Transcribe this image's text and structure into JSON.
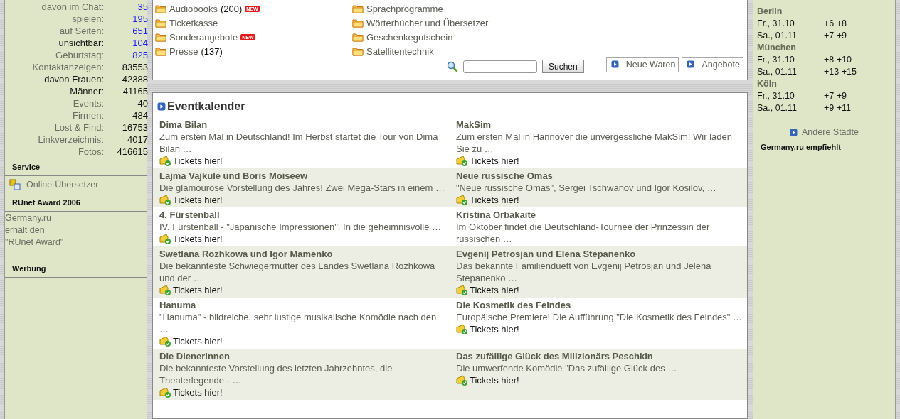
{
  "stats": [
    {
      "label": "davon im Chat:",
      "value": "35",
      "value_link": true,
      "label_strong": false
    },
    {
      "label": "spielen:",
      "value": "195",
      "value_link": true,
      "label_strong": false
    },
    {
      "label": "auf Seiten:",
      "value": "651",
      "value_link": true,
      "label_strong": false
    },
    {
      "label": "unsichtbar:",
      "value": "104",
      "value_link": true,
      "label_strong": true
    },
    {
      "label": "Geburtstag:",
      "value": "825",
      "value_link": true,
      "label_strong": false
    },
    {
      "label": "Kontaktanzeigen:",
      "value": "83553",
      "value_link": false,
      "label_strong": false
    },
    {
      "label": "davon Frauen:",
      "value": "42388",
      "value_link": false,
      "label_strong": true
    },
    {
      "label": "Männer:",
      "value": "41165",
      "value_link": false,
      "label_strong": true
    },
    {
      "label": "Events:",
      "value": "40",
      "value_link": false,
      "label_strong": false
    },
    {
      "label": "Firmen:",
      "value": "484",
      "value_link": false,
      "label_strong": false
    },
    {
      "label": "Lost & Find:",
      "value": "16753",
      "value_link": false,
      "label_strong": false
    },
    {
      "label": "Linkverzeichnis:",
      "value": "4017",
      "value_link": false,
      "label_strong": false
    },
    {
      "label": "Fotos:",
      "value": "416615",
      "value_link": false,
      "label_strong": false
    }
  ],
  "service": {
    "heading": "Service",
    "link": "Online-Übersetzer"
  },
  "award": {
    "heading": "RUnet Award 2006",
    "lines": [
      "Germany.ru",
      "erhält den",
      "\"RUnet Award\""
    ]
  },
  "ads": {
    "heading": "Werbung"
  },
  "categories": [
    {
      "name": "Audiobooks",
      "count": "(200)",
      "new_badge": "NEW"
    },
    {
      "name": "Sprachprogramme"
    },
    {
      "name": "Ticketkasse"
    },
    {
      "name": "Wörterbücher und Übersetzer"
    },
    {
      "name": "Sonderangebote",
      "new_badge": "NEW"
    },
    {
      "name": "Geschenkegutschein"
    },
    {
      "name": "Presse",
      "count": "(137)"
    },
    {
      "name": "Satellitentechnik"
    }
  ],
  "search": {
    "button": "Suchen"
  },
  "shop_links": [
    "Neue Waren",
    "Angebote"
  ],
  "events": {
    "title": "Eventkalender",
    "items": [
      {
        "title": "Dima Bilan",
        "text": "Zum ersten Mal in Deutschland! Im Herbst startet die Tour von Dima Bilan …",
        "tickets": "Tickets hier!"
      },
      {
        "title": "MakSim",
        "text": "Zum ersten Mal in Hannover die unvergessliche MakSim! Wir laden Sie zu …",
        "tickets": "Tickets hier!"
      },
      {
        "title": "Lajma Vajkule und Boris Moiseew",
        "text": "Die glamouröse Vorstellung des Jahres! Zwei Mega-Stars in einem …",
        "tickets": "Tickets hier!"
      },
      {
        "title": "Neue russische Omas",
        "text": "\"Neue russische Omas\", Sergei Tschwanov und Igor Kosilov, …",
        "tickets": "Tickets hier!"
      },
      {
        "title": "4. Fürstenball",
        "text": "IV. Fürstenball - \"Japanische Impressionen\". In die geheimnisvolle …",
        "tickets": "Tickets hier!"
      },
      {
        "title": "Kristina Orbakaite",
        "text": "Im Oktober findet die Deutschland-Tournee der Prinzessin der russischen …"
      },
      {
        "title": "Swetlana Rozhkowa und Igor Mamenko",
        "text": "Die bekannteste Schwiegermutter des Landes Swetlana Rozhkowa und der …",
        "tickets": "Tickets hier!"
      },
      {
        "title": "Evgenij Petrosjan und Elena Stepanenko",
        "text": "Das bekannte Familienduett von Evgenij Petrosjan und Jelena Stepanenko …",
        "tickets": "Tickets hier!"
      },
      {
        "title": "Hanuma",
        "text": "\"Hanuma\" - bildreiche, sehr lustige musikalische Komödie nach den …",
        "tickets": "Tickets hier!"
      },
      {
        "title": "Die Kosmetik des Feindes",
        "text": "Europäische Premiere! Die Aufführung \"Die Kosmetik des Feindes\" …",
        "tickets": "Tickets hier!"
      },
      {
        "title": "Die Dienerinnen",
        "text": "Die bekannteste Vorstellung des letzten Jahrzehntes, die Theaterlegende - …",
        "tickets": "Tickets hier!"
      },
      {
        "title": "Das zufällige Glück des Milizionärs Peschkin",
        "text": "Die umwerfende Komödie \"Das zufällige Glück des …",
        "tickets": "Tickets hier!"
      }
    ]
  },
  "weather": [
    {
      "city": "Berlin",
      "days": [
        {
          "date": "Fr., 31.10",
          "temps": "+6 +8"
        },
        {
          "date": "Sa., 01.11",
          "temps": "+7 +9"
        }
      ]
    },
    {
      "city": "München",
      "days": [
        {
          "date": "Fr., 31.10",
          "temps": "+8 +10"
        },
        {
          "date": "Sa., 01.11",
          "temps": "+13 +15"
        }
      ]
    },
    {
      "city": "Köln",
      "days": [
        {
          "date": "Fr., 31.10",
          "temps": "+7 +9"
        },
        {
          "date": "Sa., 01.11",
          "temps": "+9 +11"
        }
      ]
    }
  ],
  "other_cities": "Andere Städte",
  "recommends": {
    "heading": "Germany.ru empfiehlt"
  }
}
